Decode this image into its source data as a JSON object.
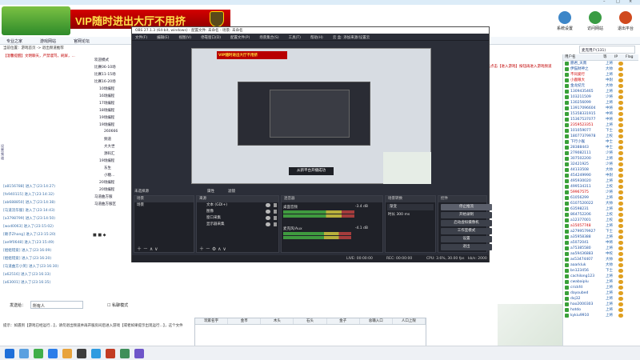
{
  "window": {
    "title": ""
  },
  "logo": {
    "line1": "",
    "line2": ""
  },
  "banner": {
    "text": "VIP随时进出大厅不用挤"
  },
  "toolbar": {
    "items": [
      {
        "label": "系统设置",
        "color": "#3d86c8"
      },
      {
        "label": "访问网站",
        "color": "#3a9c44"
      },
      {
        "label": "退出平台",
        "color": "#d04a1e"
      }
    ]
  },
  "nav": {
    "items": [
      "专业之家",
      "游戏网站",
      "官网论坛"
    ],
    "right_tab": "麦克用户(131)"
  },
  "breadcrumb": "当前位置：游戏首页 -> 退出频道推荐",
  "notice_left": "【温馨提醒】文明聊天，严禁谩骂，刷屏，...",
  "notice_right": "请先点击【进入游戏】按钮再进入游戏频道",
  "tree": {
    "items": [
      "欢迎模式",
      "比赛06-10场",
      "比赛11-15场",
      "比赛16-20场",
      "10场编程",
      "16场编程",
      "17场编程",
      "18场编程",
      "19场编程",
      "19场编程",
      "260666",
      "频道",
      "大大世",
      "源码汇",
      "19场编程",
      "东生",
      "小糖...",
      "20场编程",
      "20场编程",
      "马道曲方服",
      "马道曲方服区"
    ]
  },
  "chatlog": {
    "lines": [
      "[a8156788] 进入了(23:14:27)",
      "[fe940115] 进入了(23:14:32)",
      "[ab688850] 进入了(23:14:38)",
      "[马道流华服] 进入了(23:14:43)",
      "[a3798799] 进入了(23:14:50)",
      "[wod0063] 进入了(23:15:02)",
      "[赖子Zhang] 进入了(23:15:20)",
      "[ae9f0648] 进入了(23:15:49)",
      "[姐姐错爱] 进入了(23:16:09)",
      "[姐姐错爱] 进入了(23:16:20)",
      "[马道曲方小英] 进入了(23:16:30)",
      "[a62516] 进入了(23:16:33)",
      "[a63001] 进入了(23:16:35)"
    ]
  },
  "chat_input": {
    "label": "发送给：",
    "target": "所有人",
    "checkbox": "私聊模式"
  },
  "hint": "提示：如遇到【游戏已经运行...】，请勿退出频道并再开服房间后进入游戏【或者如果提示出现运行...】，这个文件",
  "bottom_table": {
    "headers": [
      "玩家名字",
      "金币",
      "木头",
      "石头",
      "金子",
      "总输入口",
      "人口上限"
    ]
  },
  "userlist": {
    "headers": [
      "用户名",
      "等",
      "IP",
      "Flag"
    ],
    "rows": [
      {
        "name": "愿君_天南",
        "level": "上将",
        "color": "#1a4fa0"
      },
      {
        "name": "伊猫财神之",
        "level": "大帅",
        "color": "#1a4fa0"
      },
      {
        "name": "不同爱行",
        "level": "上将",
        "color": "#d00000"
      },
      {
        "name": "小鹿眼大",
        "level": "中尉",
        "color": "#d00000"
      },
      {
        "name": "金龙纪元",
        "level": "大帅",
        "color": "#1a4fa0"
      },
      {
        "name": "1309435465",
        "level": "上将",
        "color": "#1a4fa0"
      },
      {
        "name": "103211509",
        "level": "少将",
        "color": "#1a4fa0"
      },
      {
        "name": "130256099",
        "level": "上将",
        "color": "#1a4fa0"
      },
      {
        "name": "13917096604",
        "level": "中将",
        "color": "#1a4fa0"
      },
      {
        "name": "15358331915",
        "level": "中将",
        "color": "#1a4fa0"
      },
      {
        "name": "15367537077",
        "level": "中将",
        "color": "#1a4fa0"
      },
      {
        "name": "2359523351",
        "level": "上将",
        "color": "#d00000"
      },
      {
        "name": "101059077",
        "level": "下士",
        "color": "#1a4fa0"
      },
      {
        "name": "18077379978",
        "level": "上校",
        "color": "#1a4fa0"
      },
      {
        "name": "下行小猴",
        "level": "中士",
        "color": "#1a4fa0"
      },
      {
        "name": "28388443",
        "level": "中士",
        "color": "#1a4fa0"
      },
      {
        "name": "279082111",
        "level": "少将",
        "color": "#1a4fa0"
      },
      {
        "name": "307502200",
        "level": "上将",
        "color": "#1a4fa0"
      },
      {
        "name": "32421925",
        "level": "少将",
        "color": "#1a4fa0"
      },
      {
        "name": "44133508",
        "level": "大帅",
        "color": "#1a4fa0"
      },
      {
        "name": "454249990",
        "level": "中尉",
        "color": "#1a4fa0"
      },
      {
        "name": "495930020",
        "level": "上将",
        "color": "#1a4fa0"
      },
      {
        "name": "499534311",
        "level": "上校",
        "color": "#1a4fa0"
      },
      {
        "name": "59967575",
        "level": "少将",
        "color": "#d00000"
      },
      {
        "name": "61056299",
        "level": "上将",
        "color": "#1a4fa0"
      },
      {
        "name": "6107520022",
        "level": "大帅",
        "color": "#1a4fa0"
      },
      {
        "name": "63598231",
        "level": "上将",
        "color": "#1a4fa0"
      },
      {
        "name": "864752206",
        "level": "上校",
        "color": "#1a4fa0"
      },
      {
        "name": "a12377001",
        "level": "上校",
        "color": "#1a4fa0"
      },
      {
        "name": "a15057748",
        "level": "上将",
        "color": "#d00000"
      },
      {
        "name": "a2799579927",
        "level": "下士",
        "color": "#1a4fa0"
      },
      {
        "name": "a35958388",
        "level": "上将",
        "color": "#1a4fa0"
      },
      {
        "name": "a5072041",
        "level": "中将",
        "color": "#1a4fa0"
      },
      {
        "name": "a75385580",
        "level": "上将",
        "color": "#1a4fa0"
      },
      {
        "name": "aa59436883",
        "level": "中校",
        "color": "#1a4fa0"
      },
      {
        "name": "as53474407",
        "level": "大帅",
        "color": "#1a4fa0"
      },
      {
        "name": "aaarkluk",
        "level": "大帅",
        "color": "#1a4fa0"
      },
      {
        "name": "bn123456",
        "level": "下士",
        "color": "#1a4fa0"
      },
      {
        "name": "cachilong123",
        "level": "上将",
        "color": "#1a4fa0"
      },
      {
        "name": "cwabaiplu",
        "level": "上将",
        "color": "#1a4fa0"
      },
      {
        "name": "crickfd",
        "level": "上将",
        "color": "#1a4fa0"
      },
      {
        "name": "dayoubed",
        "level": "上将",
        "color": "#1a4fa0"
      },
      {
        "name": "dxj32",
        "level": "上将",
        "color": "#1a4fa0"
      },
      {
        "name": "hao2000303",
        "level": "上将",
        "color": "#1a4fa0"
      },
      {
        "name": "hotdo",
        "level": "上将",
        "color": "#1a4fa0"
      },
      {
        "name": "kykiu9910",
        "level": "上将",
        "color": "#1a4fa0"
      }
    ]
  },
  "obs": {
    "title": "OBS 27.1.3 (64-bit, windows) - 配置文件: 未命名 - 场景: 未命名",
    "menu": [
      "文件(F)",
      "编辑(E)",
      "视图(V)",
      "停靠窗口(D)",
      "配置文件(P)",
      "场景集合(S)",
      "工具(T)",
      "帮助(H)",
      "云 盒: 添加来源/设置云"
    ],
    "preview_banner": "VIP随时进出大厅不用挤",
    "preview_tip": "从新平台开播成功",
    "source_bar": "未选择源",
    "props_label": "属性",
    "filter_label": "滤镜",
    "docks": {
      "scenes": {
        "title": "场景",
        "items": [
          "场景"
        ]
      },
      "sources": {
        "title": "来源",
        "items": [
          "文本 (GDI+)",
          "图像",
          "窗口采集",
          "显示器采集"
        ]
      },
      "mixer": {
        "title": "混音器",
        "channels": [
          {
            "name": "桌面音频",
            "db": "-3.4 dB",
            "level": 0.75
          },
          {
            "name": "麦克风/Aux",
            "db": "-4.1 dB",
            "level": 0.72
          }
        ]
      },
      "transitions": {
        "title": "场景转换",
        "type": "渐变",
        "duration_label": "时长",
        "duration": "300 ms"
      },
      "controls": {
        "title": "控件",
        "buttons": [
          "停止推流",
          "开始录制",
          "启动虚拟摄像机",
          "工作室模式",
          "设置",
          "退出"
        ]
      }
    },
    "status": {
      "live": "LIVE: 00:00:00",
      "rec": "REC: 00:00:00",
      "cpu": "CPU: 3.6%, 30.00 fps",
      "kbps": "kb/s: 2000"
    }
  },
  "misc": {
    "left_scroll_label": "设置频道",
    "footer_left": "■ ■ ◆"
  }
}
